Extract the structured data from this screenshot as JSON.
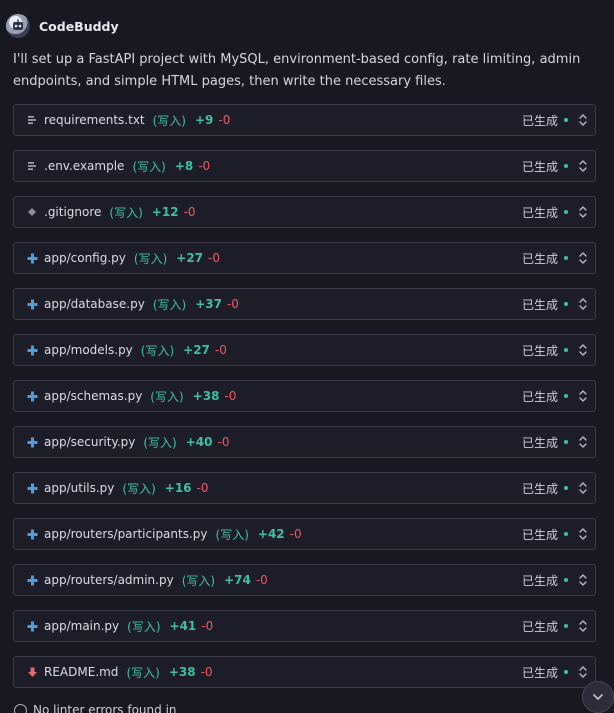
{
  "app": {
    "name": "CodeBuddy"
  },
  "message": {
    "text": "I'll set up a FastAPI project with MySQL, environment-based config, rate limiting, admin endpoints, and simple HTML pages, then write the necessary files."
  },
  "files": [
    {
      "name": "requirements.txt",
      "action": "(写入)",
      "added": "+9",
      "removed": "-0",
      "status": "已生成",
      "icon": "text-file-icon"
    },
    {
      "name": ".env.example",
      "action": "(写入)",
      "added": "+8",
      "removed": "-0",
      "status": "已生成",
      "icon": "text-file-icon"
    },
    {
      "name": ".gitignore",
      "action": "(写入)",
      "added": "+12",
      "removed": "-0",
      "status": "已生成",
      "icon": "git-diamond-icon"
    },
    {
      "name": "app/config.py",
      "action": "(写入)",
      "added": "+27",
      "removed": "-0",
      "status": "已生成",
      "icon": "python-file-icon"
    },
    {
      "name": "app/database.py",
      "action": "(写入)",
      "added": "+37",
      "removed": "-0",
      "status": "已生成",
      "icon": "python-file-icon"
    },
    {
      "name": "app/models.py",
      "action": "(写入)",
      "added": "+27",
      "removed": "-0",
      "status": "已生成",
      "icon": "python-file-icon"
    },
    {
      "name": "app/schemas.py",
      "action": "(写入)",
      "added": "+38",
      "removed": "-0",
      "status": "已生成",
      "icon": "python-file-icon"
    },
    {
      "name": "app/security.py",
      "action": "(写入)",
      "added": "+40",
      "removed": "-0",
      "status": "已生成",
      "icon": "python-file-icon"
    },
    {
      "name": "app/utils.py",
      "action": "(写入)",
      "added": "+16",
      "removed": "-0",
      "status": "已生成",
      "icon": "python-file-icon"
    },
    {
      "name": "app/routers/participants.py",
      "action": "(写入)",
      "added": "+42",
      "removed": "-0",
      "status": "已生成",
      "icon": "python-file-icon"
    },
    {
      "name": "app/routers/admin.py",
      "action": "(写入)",
      "added": "+74",
      "removed": "-0",
      "status": "已生成",
      "icon": "python-file-icon"
    },
    {
      "name": "app/main.py",
      "action": "(写入)",
      "added": "+41",
      "removed": "-0",
      "status": "已生成",
      "icon": "python-file-icon"
    },
    {
      "name": "README.md",
      "action": "(写入)",
      "added": "+38",
      "removed": "-0",
      "status": "已生成",
      "icon": "markdown-download-icon"
    }
  ],
  "footer": {
    "text": "No linter errors found in"
  },
  "colors": {
    "background": "#181822",
    "row_background": "#1d1d2a",
    "row_border": "#3a3a4c",
    "added": "#3fc0a2",
    "removed": "#f0575d",
    "python_icon": "#4d9de0",
    "markdown_icon": "#e06a74"
  }
}
